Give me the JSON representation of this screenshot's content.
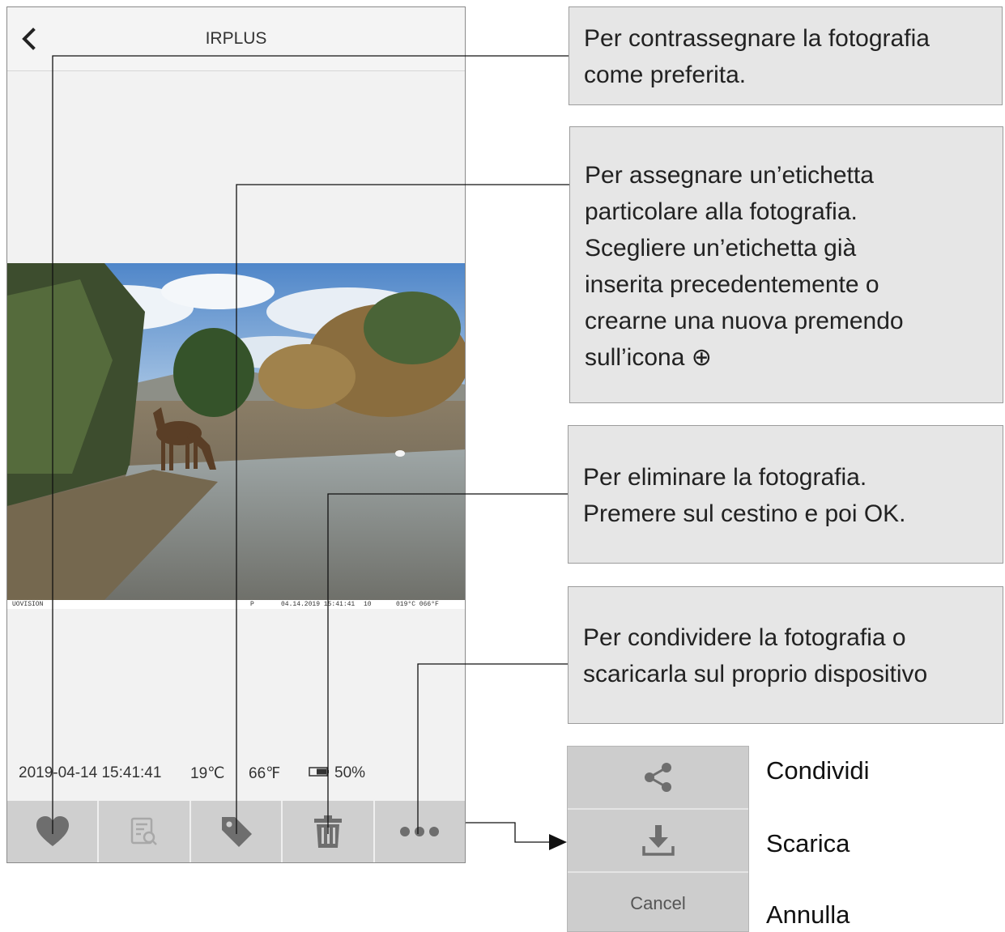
{
  "app": {
    "title": "IRPLUS",
    "back_icon": "chevron-left-icon"
  },
  "photo": {
    "stamp": {
      "brand": "UOVISION",
      "mode": "P",
      "datetime": "04.14.2019 15:41:41",
      "moon": "10",
      "temperature": "019°C 066°F"
    }
  },
  "info": {
    "datetime": "2019-04-14 15:41:41",
    "temp_c": "19℃",
    "temp_f": "66℉",
    "battery": "50%"
  },
  "toolbar": [
    {
      "icon": "heart-icon"
    },
    {
      "icon": "document-search-icon"
    },
    {
      "icon": "tag-icon"
    },
    {
      "icon": "trash-icon"
    },
    {
      "icon": "more-dots-icon"
    }
  ],
  "callouts": {
    "favorite": [
      "Per contrassegnare la fotografia",
      "come preferita."
    ],
    "tag": [
      "Per assegnare un’etichetta",
      "particolare alla fotografia.",
      "Scegliere un’etichetta già",
      "inserita precedentemente o",
      "crearne una nuova premendo",
      "sull’icona ⊕"
    ],
    "delete": [
      "Per eliminare la fotografia.",
      "Premere sul cestino e poi OK."
    ],
    "share": [
      "Per condividere la fotografia o",
      "scaricarla sul proprio dispositivo"
    ]
  },
  "sheet": {
    "cancel_label": "Cancel",
    "labels": [
      "Condividi",
      "Scarica",
      "Annulla"
    ]
  },
  "colors": {
    "toolbar_bg": "#cfcfcf",
    "icon_gray": "#6e6e6e",
    "callout_bg": "#e6e6e6"
  }
}
